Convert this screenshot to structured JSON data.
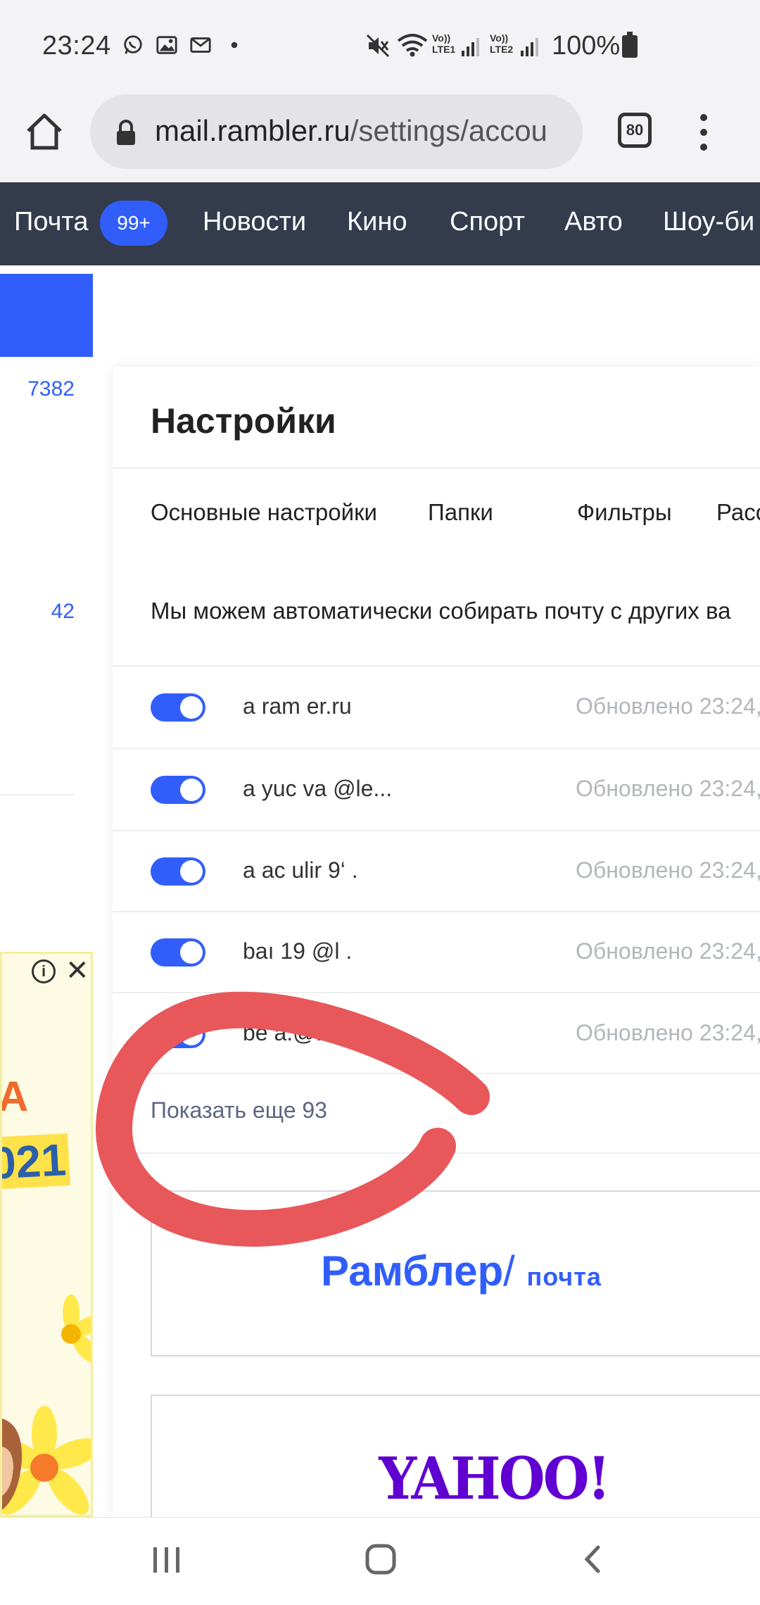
{
  "status_bar": {
    "time": "23:24",
    "battery_text": "100%",
    "sim1_label": "LTE1",
    "sim2_label": "LTE2",
    "volte": "Vo))"
  },
  "browser": {
    "url_host": "mail.rambler.ru",
    "url_path": "/settings/accou",
    "tab_count": "80"
  },
  "top_nav": {
    "items": [
      "Почта",
      "Новости",
      "Кино",
      "Спорт",
      "Авто",
      "Шоу-би"
    ],
    "mail_badge": "99+"
  },
  "sidebar": {
    "counts": [
      "7382",
      "42"
    ]
  },
  "ad": {
    "text_a": "А",
    "text_year": "021"
  },
  "settings": {
    "title": "Настройки",
    "tabs": [
      "Основные настройки",
      "Папки",
      "Фильтры",
      "Рассыл"
    ],
    "info_text": "Мы можем автоматически собирать почту с других ва",
    "accounts": [
      {
        "email": "a          ram    er.ru",
        "updated": "Обновлено 23:24,",
        "enabled": true
      },
      {
        "email": "a       yuc    va   @le...",
        "updated": "Обновлено 23:24,",
        "enabled": true
      },
      {
        "email": "a       ac   ulir    9‘   .",
        "updated": "Обновлено 23:24,",
        "enabled": true
      },
      {
        "email": "baı            19   @l   .",
        "updated": "Обновлено 23:24,",
        "enabled": true
      },
      {
        "email": "be                     a.@...",
        "updated": "Обновлено 23:24,",
        "enabled": true
      }
    ],
    "show_more": "Показать еще 93",
    "providers": [
      {
        "name": "Рамблер",
        "slash": "/",
        "sub": "почта"
      },
      {
        "name": "YAHOO!"
      }
    ]
  },
  "colors": {
    "accent": "#315efb",
    "nav_bg": "#343b4c",
    "annotation": "#e8575a",
    "yahoo": "#6001d2"
  }
}
